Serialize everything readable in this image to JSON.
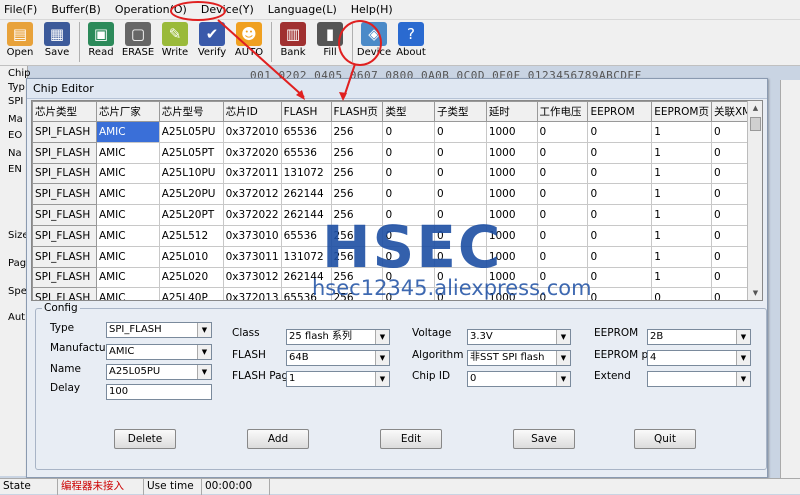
{
  "menu": [
    "File(F)",
    "Buffer(B)",
    "Operation(O)",
    "Device(Y)",
    "Language(L)",
    "Help(H)"
  ],
  "toolbar": [
    {
      "label": "Open",
      "icon": "folder-open-icon",
      "color": "#e8a23a",
      "glyph": "▤"
    },
    {
      "label": "Save",
      "icon": "floppy-icon",
      "color": "#3c5a9a",
      "glyph": "▦"
    },
    {
      "label": "Read",
      "icon": "read-chip-icon",
      "color": "#2c8a5a",
      "glyph": "▣"
    },
    {
      "label": "ERASE",
      "icon": "eraser-icon",
      "color": "#666666",
      "glyph": "▢"
    },
    {
      "label": "Write",
      "icon": "write-icon",
      "color": "#9aba3a",
      "glyph": "✎"
    },
    {
      "label": "Verify",
      "icon": "verify-icon",
      "color": "#3a5aaa",
      "glyph": "✔"
    },
    {
      "label": "AUTO",
      "icon": "auto-run-icon",
      "color": "#f0a020",
      "glyph": "☻"
    },
    {
      "label": "Bank",
      "icon": "bank-icon",
      "color": "#a03030",
      "glyph": "▥"
    },
    {
      "label": "Fill",
      "icon": "fill-icon",
      "color": "#555555",
      "glyph": "▮"
    },
    {
      "label": "Device",
      "icon": "device-chip-icon",
      "color": "#4a8ac8",
      "glyph": "◈"
    },
    {
      "label": "About",
      "icon": "about-help-icon",
      "color": "#2a6ad0",
      "glyph": "?"
    }
  ],
  "bg_hex": "001 0202 0405 0607 0800 0A0B 0C0D 0E0F  0123456789ABCDEF",
  "bg_left_labels": [
    "Chip",
    "Typ",
    "SPI",
    "Ma",
    "EO",
    "Na",
    "EN",
    "Size",
    "Pag",
    "Spe",
    "Aut"
  ],
  "dialog_title": "Chip Editor",
  "table": {
    "headers": [
      "芯片类型",
      "芯片厂家",
      "芯片型号",
      "芯片ID",
      "FLASH",
      "FLASH页",
      "类型",
      "子类型",
      "延时",
      "工作电压",
      "EEPROM",
      "EEPROM页",
      "关联XML"
    ],
    "rows": [
      [
        "SPI_FLASH",
        "AMIC",
        "A25L05PU",
        "0x372010",
        "65536",
        "256",
        "0",
        "0",
        "1000",
        "0",
        "0",
        "1",
        "0"
      ],
      [
        "SPI_FLASH",
        "AMIC",
        "A25L05PT",
        "0x372020",
        "65536",
        "256",
        "0",
        "0",
        "1000",
        "0",
        "0",
        "1",
        "0"
      ],
      [
        "SPI_FLASH",
        "AMIC",
        "A25L10PU",
        "0x372011",
        "131072",
        "256",
        "0",
        "0",
        "1000",
        "0",
        "0",
        "1",
        "0"
      ],
      [
        "SPI_FLASH",
        "AMIC",
        "A25L20PU",
        "0x372012",
        "262144",
        "256",
        "0",
        "0",
        "1000",
        "0",
        "0",
        "1",
        "0"
      ],
      [
        "SPI_FLASH",
        "AMIC",
        "A25L20PT",
        "0x372022",
        "262144",
        "256",
        "0",
        "0",
        "1000",
        "0",
        "0",
        "1",
        "0"
      ],
      [
        "SPI_FLASH",
        "AMIC",
        "A25L512",
        "0x373010",
        "65536",
        "256",
        "0",
        "0",
        "1000",
        "0",
        "0",
        "1",
        "0"
      ],
      [
        "SPI_FLASH",
        "AMIC",
        "A25L010",
        "0x373011",
        "131072",
        "256",
        "0",
        "0",
        "1000",
        "0",
        "0",
        "1",
        "0"
      ],
      [
        "SPI_FLASH",
        "AMIC",
        "A25L020",
        "0x373012",
        "262144",
        "256",
        "0",
        "0",
        "1000",
        "0",
        "0",
        "1",
        "0"
      ],
      [
        "SPI_FLASH",
        "AMIC",
        "A25L40P",
        "0x372013",
        "65536",
        "256",
        "0",
        "0",
        "1000",
        "0",
        "0",
        "0",
        "0"
      ]
    ]
  },
  "config": {
    "legend": "Config",
    "type_label": "Type",
    "type_value": "SPI_FLASH",
    "manufacturer_label": "Manufacturer",
    "manufacturer_value": "AMIC",
    "name_label": "Name",
    "name_value": "A25L05PU",
    "delay_label": "Delay",
    "delay_value": "100",
    "class_label": "Class",
    "class_value": "25 flash 系列",
    "flash_label": "FLASH",
    "flash_value": "64B",
    "flash_page_label": "FLASH Page",
    "flash_page_value": "1",
    "voltage_label": "Voltage",
    "voltage_value": "3.3V",
    "algorithm_label": "Algorithm",
    "algorithm_value": "非SST SPI flash",
    "chip_id_label": "Chip ID",
    "chip_id_value": "0",
    "eeprom_label": "EEPROM",
    "eeprom_value": "2B",
    "eeprom_page_label": "EEPROM pag",
    "eeprom_page_value": "4",
    "extend_label": "Extend",
    "extend_value": ""
  },
  "buttons": {
    "delete": "Delete",
    "add": "Add",
    "edit": "Edit",
    "save": "Save",
    "quit": "Quit"
  },
  "status": {
    "state_label": "State",
    "programmer_status": "编程器未接入",
    "use_time_label": "Use time",
    "use_time_value": "00:00:00"
  },
  "watermark": {
    "logo_letters": "HSEC",
    "url": "hsec12345.aliexpress.com"
  },
  "colors": {
    "selection": "#3a6fd8",
    "annotation_red": "#e02020",
    "logo_blue": "#1d4fa4"
  }
}
